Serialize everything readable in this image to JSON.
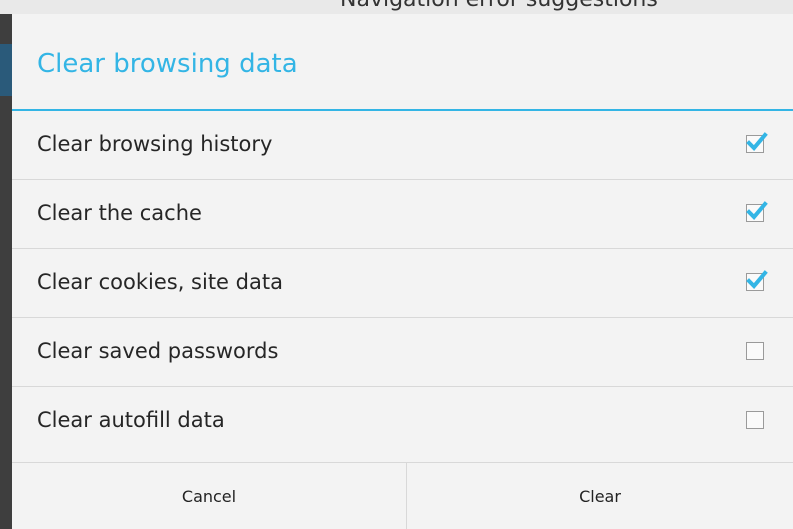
{
  "background": {
    "partial_text": "Navigation error suggestions"
  },
  "dialog": {
    "title": "Clear browsing data",
    "accent_color": "#33b5e5",
    "options": [
      {
        "label": "Clear browsing history",
        "checked": true
      },
      {
        "label": "Clear the cache",
        "checked": true
      },
      {
        "label": "Clear cookies, site data",
        "checked": true
      },
      {
        "label": "Clear saved passwords",
        "checked": false
      },
      {
        "label": "Clear autofill data",
        "checked": false
      }
    ],
    "buttons": {
      "cancel_label": "Cancel",
      "clear_label": "Clear"
    }
  }
}
